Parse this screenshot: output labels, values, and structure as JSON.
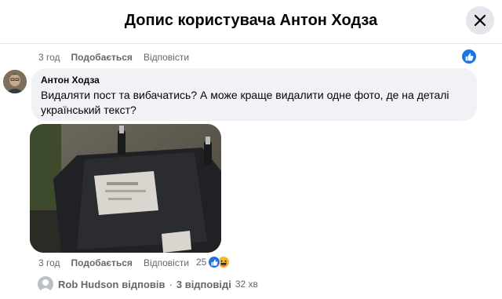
{
  "header": {
    "title": "Допис користувача Антон Ходза",
    "close_icon": "close-icon"
  },
  "prev_comment": {
    "time": "3 год",
    "like_label": "Подобається",
    "reply_label": "Відповісти",
    "reaction_icon": "like-icon"
  },
  "comment": {
    "author": "Антон Ходза",
    "text": "Видаляти пост та вибачатись? А може краще видалити одне фото, де на деталі український текст?",
    "time": "3 год",
    "like_label": "Подобається",
    "reply_label": "Відповісти",
    "reaction_count": "25",
    "reaction_icons": [
      "like-icon",
      "haha-icon"
    ]
  },
  "replies": {
    "author": "Rob Hudson",
    "action": "відповів",
    "separator": "·",
    "count_label": "3 відповіді",
    "age": "32 хв"
  },
  "colors": {
    "accent": "#1b74e4",
    "bubble": "#f0f2f5",
    "muted": "#65676b"
  }
}
